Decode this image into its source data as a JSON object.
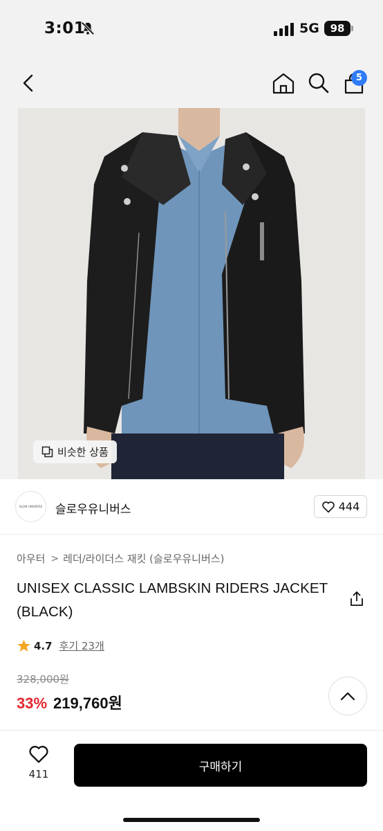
{
  "status_bar": {
    "time": "3:01",
    "network": "5G",
    "battery": "98"
  },
  "nav": {
    "cart_count": "5",
    "icons": [
      "back-icon",
      "home-icon",
      "search-icon",
      "cart-icon"
    ]
  },
  "image": {
    "similar_label": "비슷한 상품"
  },
  "brand": {
    "logo_text": "SLOW UNIVERSE",
    "name": "슬로우유니버스",
    "like_count": "444"
  },
  "breadcrumb": {
    "category": "아우터",
    "subcategory": "레더/라이더스 재킷 (슬로우유니버스)"
  },
  "product": {
    "title": "UNISEX CLASSIC LAMBSKIN RIDERS JACKET (BLACK)",
    "rating": "4.7",
    "reviews": "후기 23개",
    "original_price": "328,000원",
    "discount": "33%",
    "price": "219,760원"
  },
  "bottom": {
    "wish_count": "411",
    "buy_label": "구매하기"
  },
  "colors": {
    "accent_red": "#e3262f",
    "badge_blue": "#2f7cf6",
    "star": "#f5a623"
  }
}
